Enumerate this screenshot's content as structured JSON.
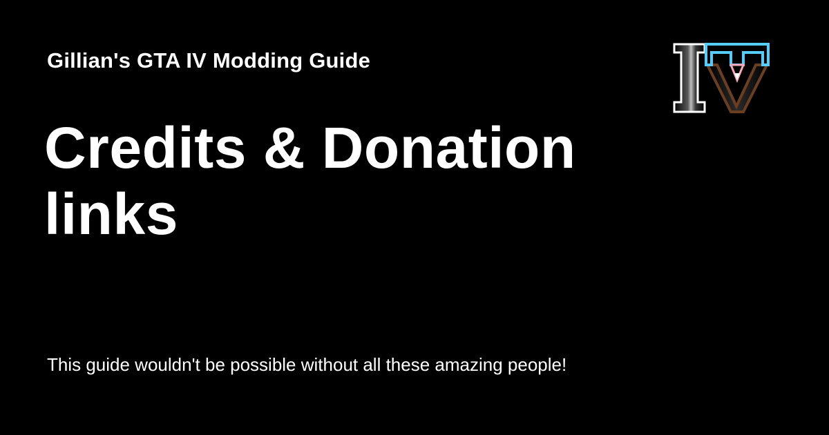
{
  "site": {
    "title": "Gillian's GTA IV Modding Guide"
  },
  "page": {
    "title": "Credits & Donation links",
    "description": "This guide wouldn't be possible without all these amazing people!"
  },
  "logo": {
    "icon": "gta-iv-logo-icon",
    "colors": {
      "i_outline": "#ffffff",
      "t_accent": "#55cdfc",
      "v_fill": "#6b3e1f",
      "v_inner": "#f7a8b8"
    }
  },
  "colors": {
    "background": "#000000",
    "text": "#ffffff"
  }
}
